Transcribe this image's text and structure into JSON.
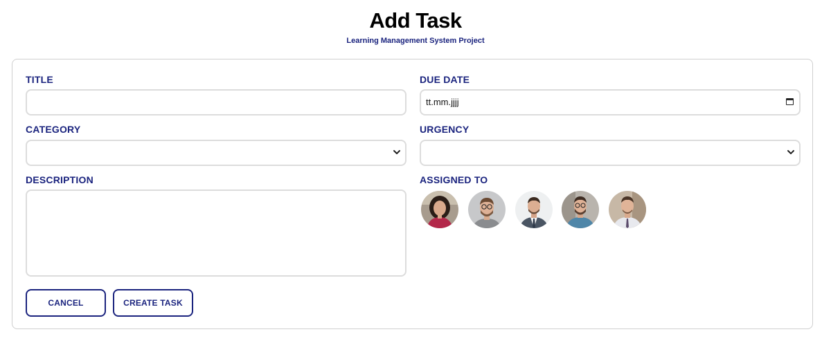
{
  "header": {
    "title": "Add Task",
    "subtitle": "Learning Management System Project"
  },
  "form": {
    "title_label": "TITLE",
    "title_value": "",
    "due_date_label": "DUE DATE",
    "due_date_value": "tt.mm.jjjj",
    "category_label": "CATEGORY",
    "category_value": "",
    "urgency_label": "URGENCY",
    "urgency_value": "",
    "description_label": "DESCRIPTION",
    "description_value": "",
    "assigned_label": "ASSIGNED TO",
    "assignees": [
      {
        "icon": "avatar-woman-dark-hair"
      },
      {
        "icon": "avatar-man-glasses"
      },
      {
        "icon": "avatar-man-suit"
      },
      {
        "icon": "avatar-man-glasses-beard"
      },
      {
        "icon": "avatar-man-shirt-tie"
      }
    ]
  },
  "buttons": {
    "cancel_label": "CANCEL",
    "create_label": "CREATE TASK"
  },
  "colors": {
    "accent": "#1a237e",
    "border": "#dcdcdc",
    "card_border": "#cfcfcf"
  }
}
